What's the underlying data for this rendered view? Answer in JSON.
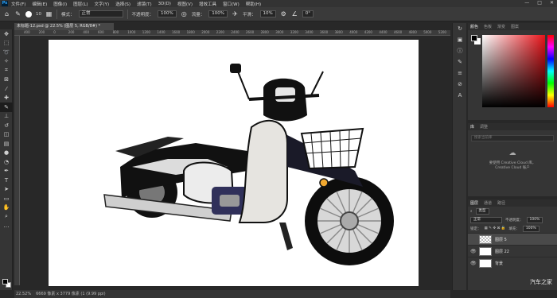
{
  "menu": {
    "logo": "Ps",
    "items": [
      "文件(F)",
      "编辑(E)",
      "图像(I)",
      "图层(L)",
      "文字(Y)",
      "选择(S)",
      "滤镜(T)",
      "3D(D)",
      "视图(V)",
      "增效工具",
      "窗口(W)",
      "帮助(H)"
    ],
    "window_controls": [
      "—",
      "□",
      "✕"
    ]
  },
  "options": {
    "brush_size": "10",
    "mode_label": "模式：",
    "mode_value": "正常",
    "opacity_label": "不透明度：",
    "opacity_value": "100%",
    "flow_label": "流量：",
    "flow_value": "100%",
    "smooth_label": "平滑：",
    "smooth_value": "10%",
    "angle_value": "0°"
  },
  "document": {
    "tab_title": "未标题-12.psd @ 22.5% (图层 5, RGB/8#) *",
    "ruler_ticks": [
      "400",
      "200",
      "0",
      "200",
      "400",
      "600",
      "800",
      "1000",
      "1200",
      "1400",
      "1600",
      "1800",
      "2000",
      "2200",
      "2400",
      "2600",
      "2800",
      "3000",
      "3200",
      "3400",
      "3600",
      "3800",
      "4000",
      "4200",
      "4400",
      "4600",
      "4800",
      "5000",
      "5200"
    ]
  },
  "status": {
    "zoom": "22.52%",
    "doc_info": "6669 像素 x 3779 像素 (1 (9.99 ppi)"
  },
  "color_panel": {
    "tabs": [
      "颜色",
      "色板",
      "渐变",
      "图案"
    ],
    "foreground": "#000000",
    "background": "#ffffff",
    "hue": "#e8141a"
  },
  "libraries_panel": {
    "tabs": [
      "库",
      "调整"
    ],
    "search_placeholder": "搜索当前库",
    "message_line1": "要使用 Creative Cloud 库，",
    "message_line2": "Creative Cloud 账户"
  },
  "layers_panel": {
    "tabs": [
      "图层",
      "通道",
      "路径"
    ],
    "filter_label": "类型",
    "blend_mode": "正常",
    "opacity_label": "不透明度：",
    "opacity_value": "100%",
    "lock_label": "锁定：",
    "fill_label": "填充：",
    "fill_value": "100%",
    "layers": [
      {
        "name": "图层 5",
        "selected": true
      },
      {
        "name": "图层 22",
        "selected": false
      },
      {
        "name": "背景",
        "selected": false
      }
    ]
  },
  "watermark": "汽车之家"
}
